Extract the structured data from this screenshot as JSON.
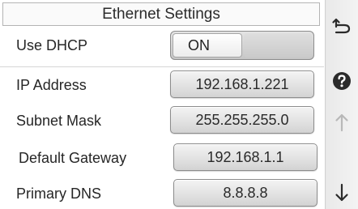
{
  "header": {
    "title": "Ethernet Settings"
  },
  "settings": [
    {
      "label": "Use DHCP",
      "type": "toggle",
      "value": "ON"
    },
    {
      "label": "IP Address",
      "type": "field",
      "value": "192.168.1.221"
    },
    {
      "label": "Subnet Mask",
      "type": "field",
      "value": "255.255.255.0"
    },
    {
      "label": "Default Gateway",
      "type": "field",
      "value": "192.168.1.1"
    },
    {
      "label": "Primary DNS",
      "type": "field",
      "value": "8.8.8.8"
    }
  ],
  "sidebar": {
    "buttons": [
      {
        "icon": "back-arrow-icon"
      },
      {
        "icon": "help-icon"
      },
      {
        "icon": "arrow-up-icon",
        "state": "disabled"
      },
      {
        "icon": "arrow-down-icon",
        "state": "enabled"
      }
    ]
  },
  "colors": {
    "icon_active": "#2b2b2b",
    "icon_disabled": "#b8b8b8",
    "button_border": "#8c8c8c"
  }
}
